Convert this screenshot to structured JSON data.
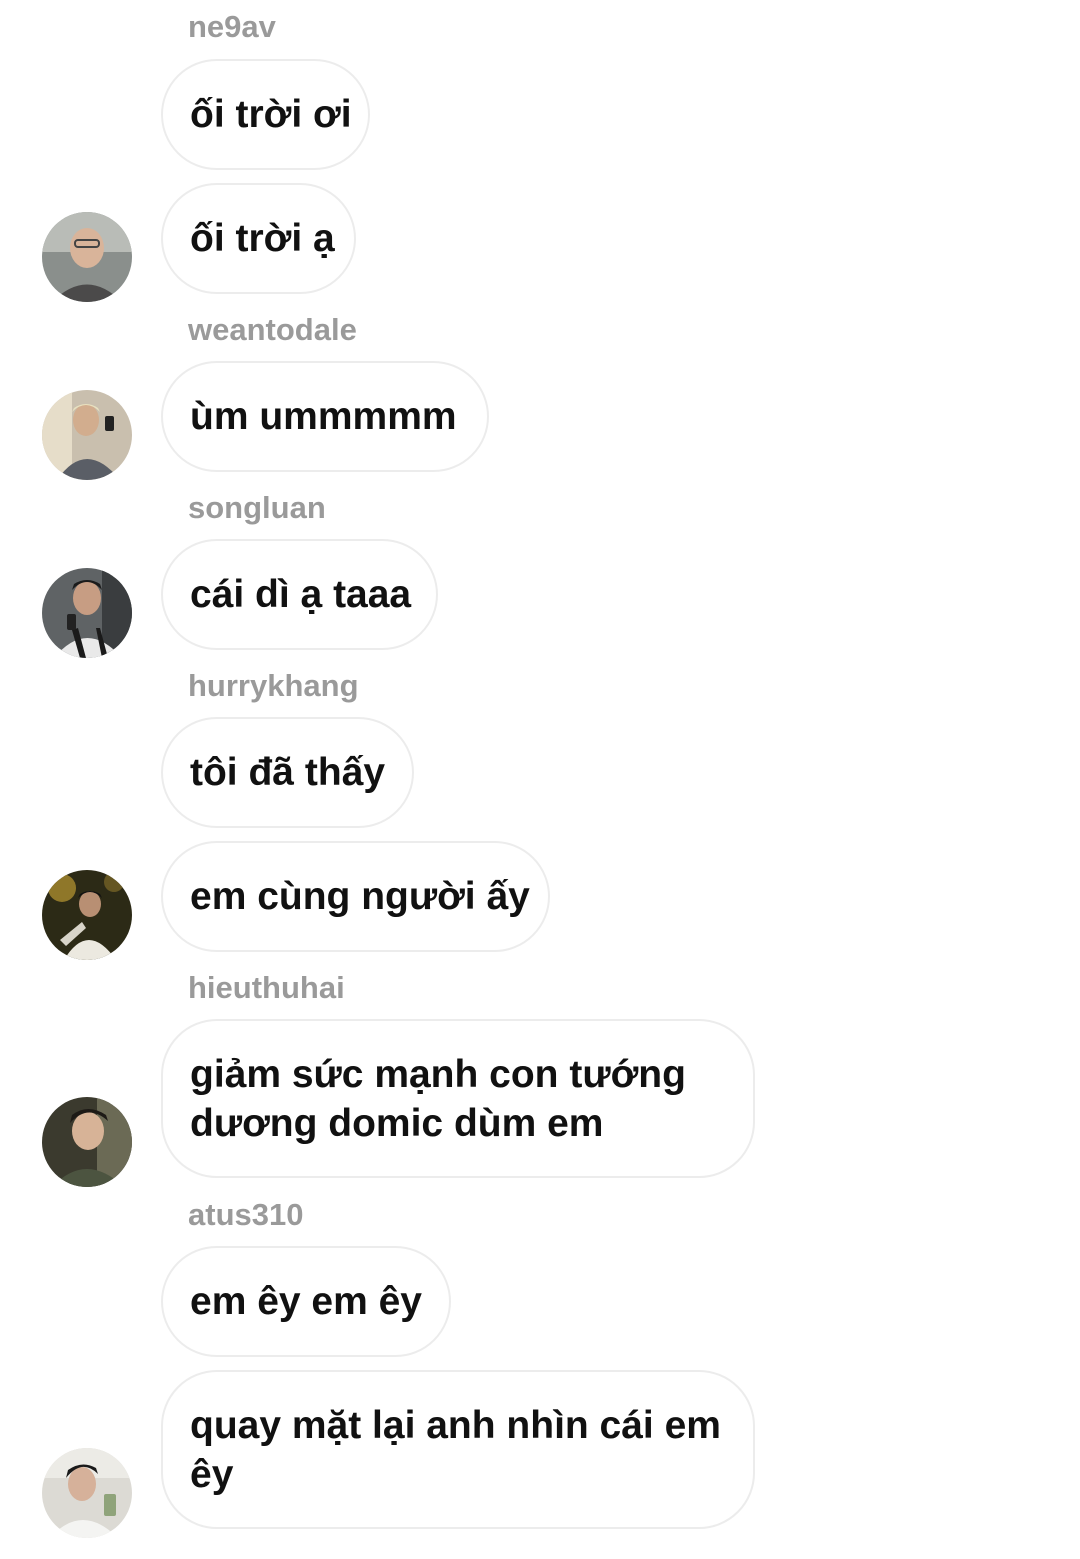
{
  "messages": [
    {
      "username": "ne9av",
      "bubbles": [
        "ối trời ơi",
        "ối trời ạ"
      ],
      "avatar": "user-avatar"
    },
    {
      "username": "weantodale",
      "bubbles": [
        "ùm ummmmm"
      ],
      "avatar": "user-avatar"
    },
    {
      "username": "songluan",
      "bubbles": [
        "cái dì ạ taaa"
      ],
      "avatar": "user-avatar"
    },
    {
      "username": "hurrykhang",
      "bubbles": [
        "tôi đã thấy",
        "em cùng người ấy"
      ],
      "avatar": "user-avatar"
    },
    {
      "username": "hieuthuhai",
      "bubbles": [
        "giảm sức mạnh con tướng",
        "dương domic dùm em"
      ],
      "avatar": "user-avatar"
    },
    {
      "username": "atus310",
      "bubbles": [
        "em êy em êy",
        "quay mặt lại anh nhìn cái em",
        "êy"
      ],
      "avatar": "user-avatar"
    }
  ],
  "colors": {
    "username": "#9a9a9a",
    "bubble_border": "#ececec",
    "text": "#111111",
    "background": "#ffffff"
  }
}
